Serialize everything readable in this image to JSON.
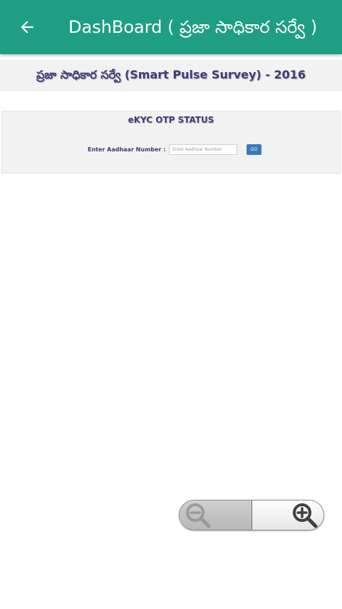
{
  "appbar": {
    "title": "DashBoard ( ప్రజా సాధికార సర్వే )",
    "back_icon": "arrow-left-icon",
    "color": "#1e9e82"
  },
  "banner": {
    "text": "ప్రజా సాధికార సర్వే (Smart Pulse Survey) - 2016"
  },
  "ekyc": {
    "title": "eKYC OTP STATUS",
    "label": "Enter Aadhaar Number :",
    "input_placeholder": "Enter Aadhaar Number",
    "input_value": "",
    "go_label": "GO"
  },
  "zoom": {
    "zoom_out_icon": "zoom-out-icon",
    "zoom_in_icon": "zoom-in-icon"
  },
  "colors": {
    "accent": "#1e9e82",
    "heading_text": "#3e3c7a",
    "go_button": "#3a7ab8"
  }
}
